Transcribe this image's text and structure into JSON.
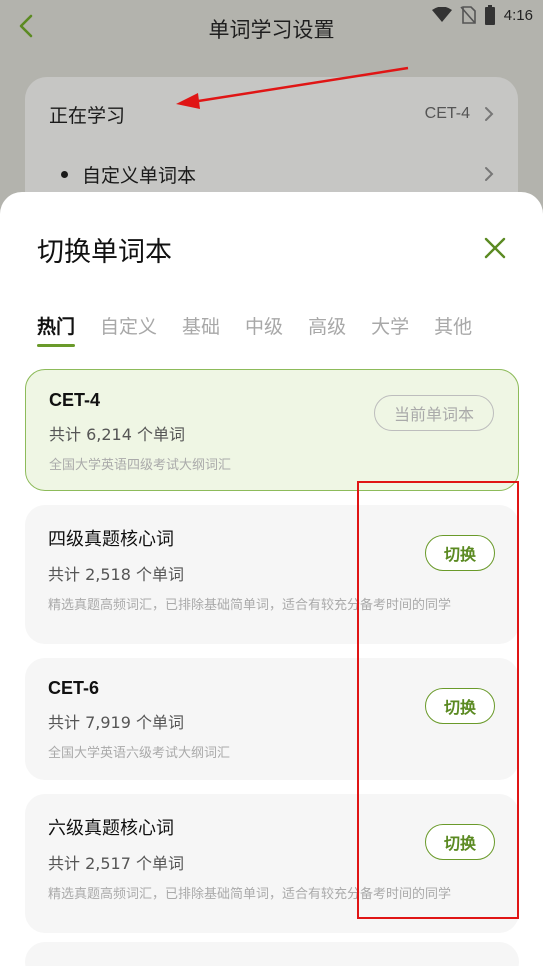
{
  "status_bar": {
    "time": "4:16",
    "icons": [
      "wifi-icon",
      "no-sim-icon",
      "battery-icon"
    ]
  },
  "nav": {
    "title": "单词学习设置",
    "back_icon": "chevron-left-icon"
  },
  "settings": {
    "studying_label": "正在学习",
    "studying_value": "CET-4",
    "custom_label": "自定义单词本"
  },
  "sheet": {
    "title": "切换单词本",
    "close_icon": "close-icon",
    "tabs": [
      "热门",
      "自定义",
      "基础",
      "中级",
      "高级",
      "大学",
      "其他"
    ],
    "active_tab": "热门",
    "books": [
      {
        "name": "CET-4",
        "count": "共计 6,214 个单词",
        "desc": "全国大学英语四级考试大纲词汇",
        "button": "当前单词本",
        "current": true
      },
      {
        "name": "四级真题核心词",
        "count": "共计 2,518 个单词",
        "desc": "精选真题高频词汇，已排除基础简单词，适合有较充分备考时间的同学",
        "button": "切换",
        "current": false
      },
      {
        "name": "CET-6",
        "count": "共计 7,919 个单词",
        "desc": "全国大学英语六级考试大纲词汇",
        "button": "切换",
        "current": false
      },
      {
        "name": "六级真题核心词",
        "count": "共计 2,517 个单词",
        "desc": "精选真题高频词汇，已排除基础简单词，适合有较充分备考时间的同学",
        "button": "切换",
        "current": false
      }
    ]
  },
  "colors": {
    "accent": "#6a9a2a",
    "overlay": "#b3b3ad",
    "annotation_red": "#e01515"
  }
}
